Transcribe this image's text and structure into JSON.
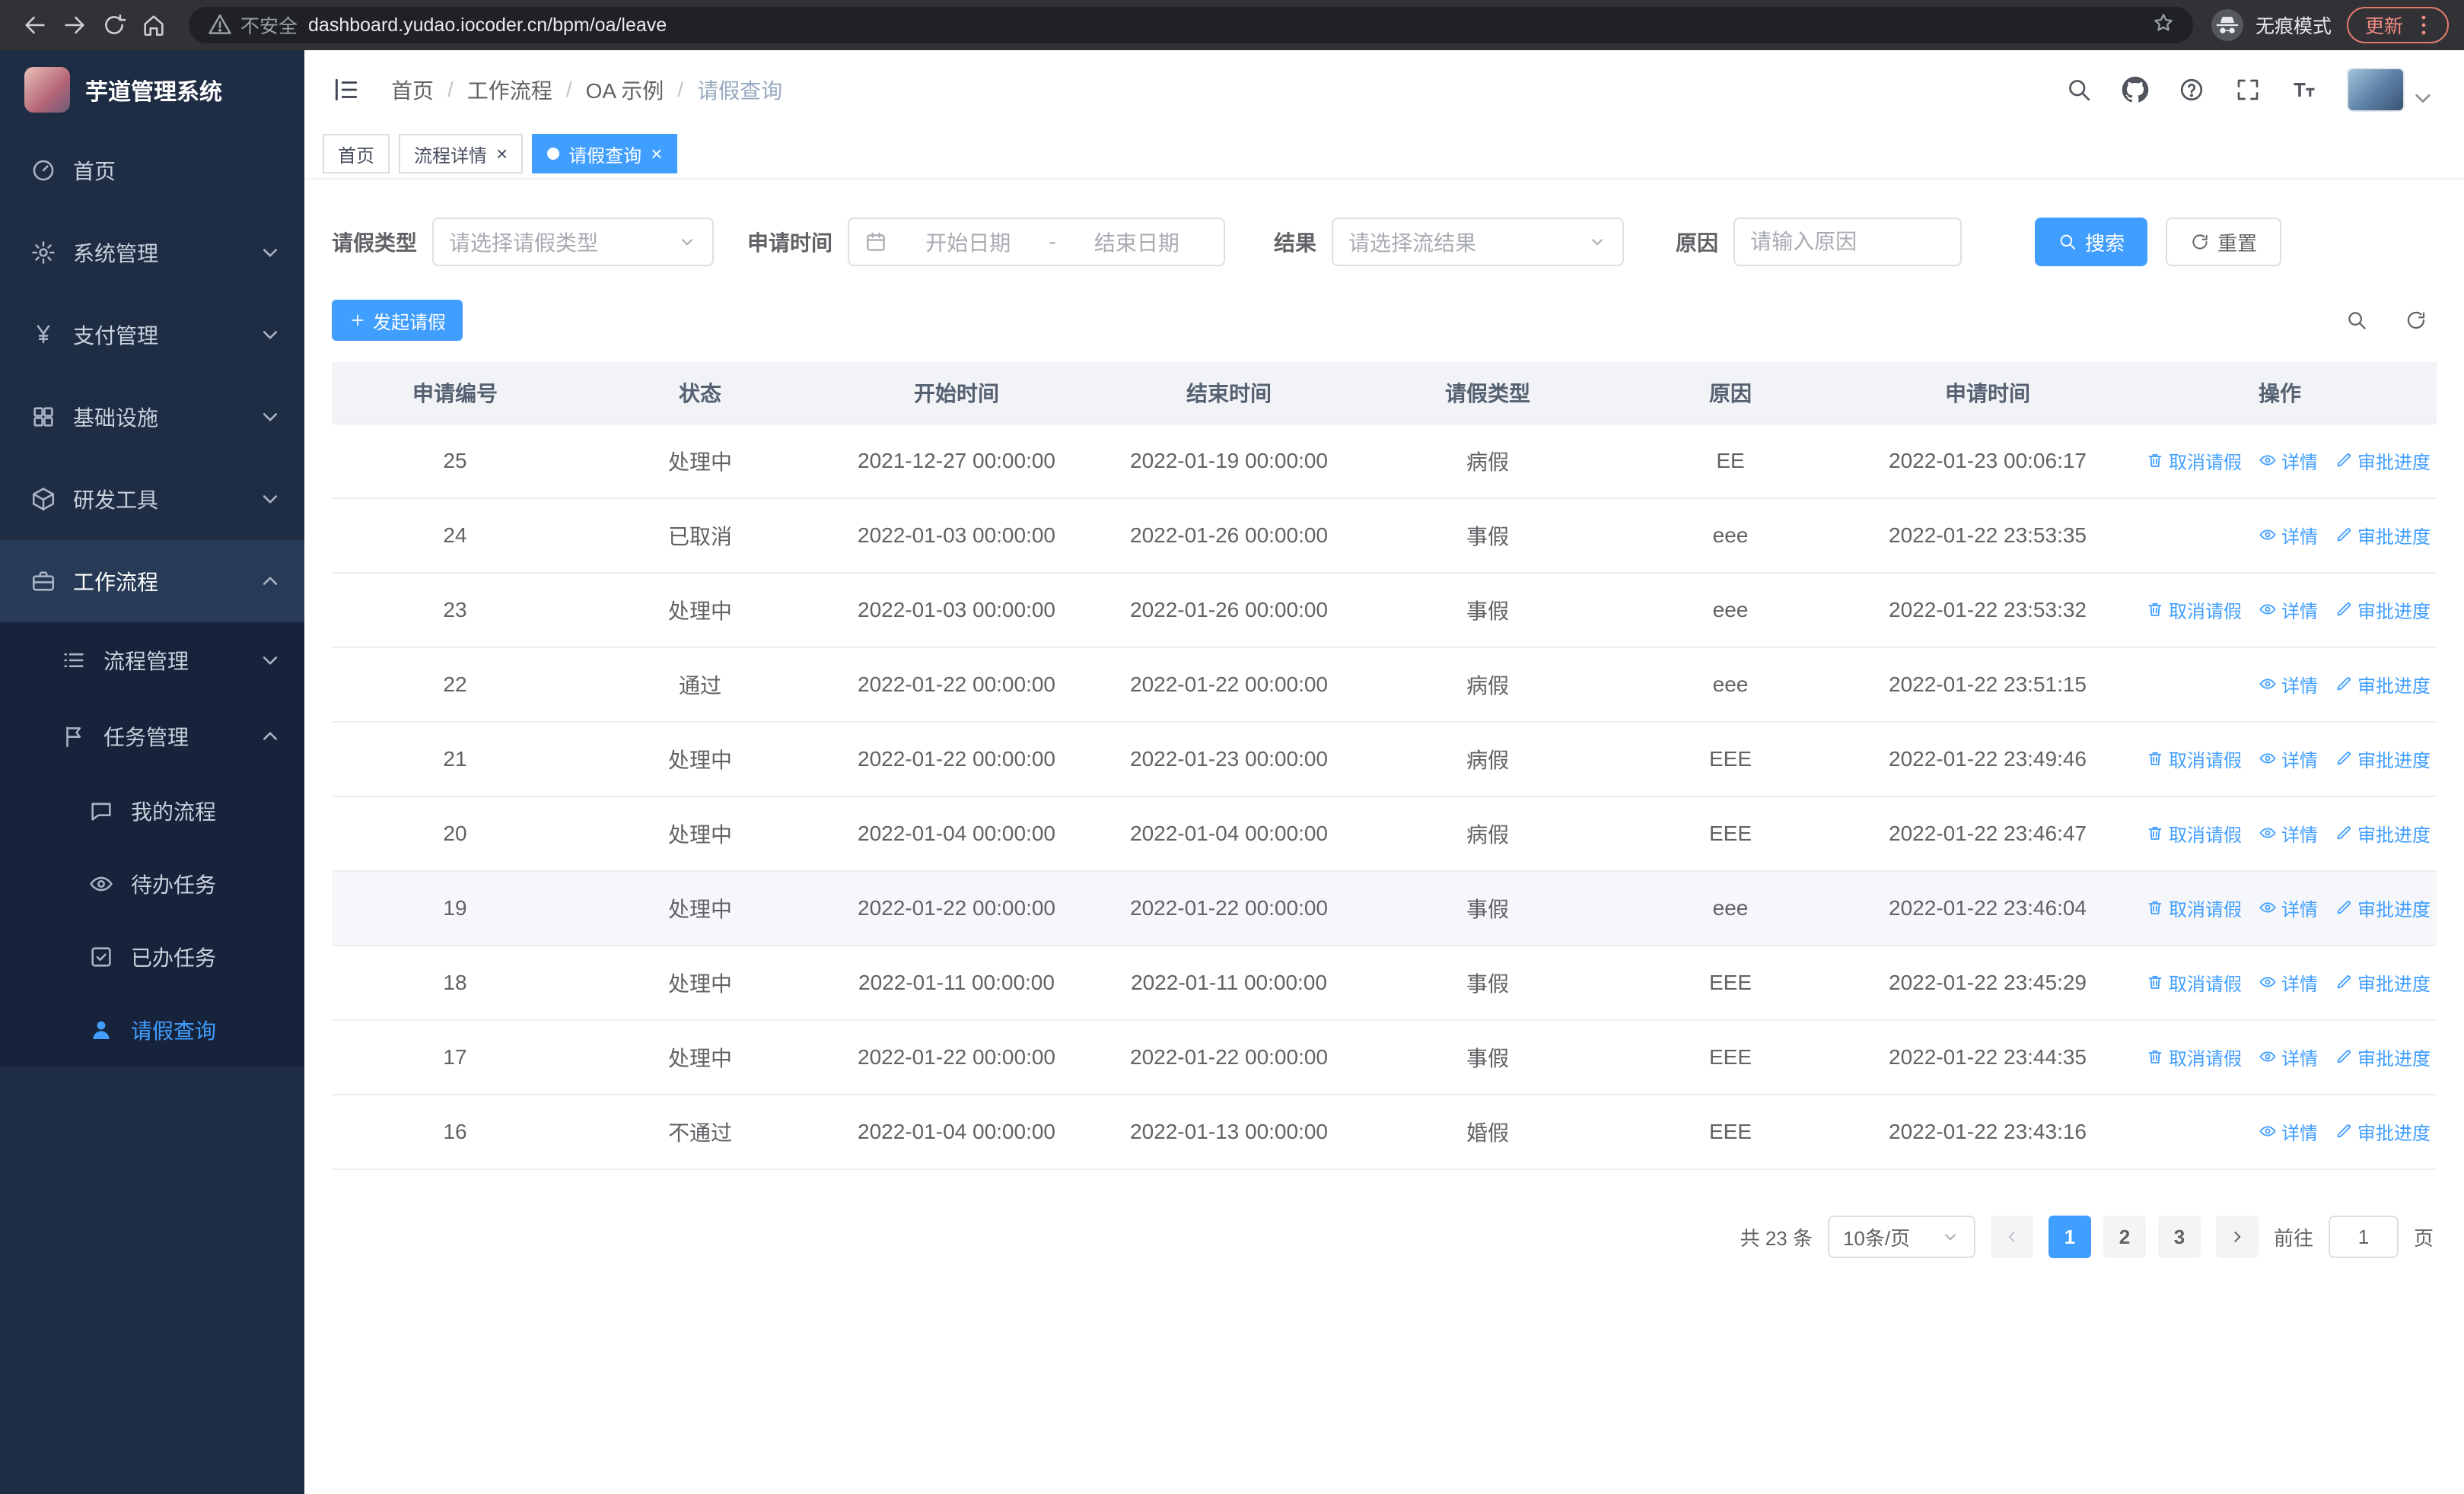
{
  "browser": {
    "security_warning": "不安全",
    "url": "dashboard.yudao.iocoder.cn/bpm/oa/leave",
    "incognito_label": "无痕模式",
    "update_label": "更新"
  },
  "app": {
    "title": "芋道管理系统"
  },
  "sidebar": {
    "items": [
      {
        "label": "首页"
      },
      {
        "label": "系统管理"
      },
      {
        "label": "支付管理"
      },
      {
        "label": "基础设施"
      },
      {
        "label": "研发工具"
      },
      {
        "label": "工作流程"
      }
    ],
    "workflow_children": [
      {
        "label": "流程管理"
      },
      {
        "label": "任务管理"
      }
    ],
    "task_children": [
      {
        "label": "我的流程"
      },
      {
        "label": "待办任务"
      },
      {
        "label": "已办任务"
      },
      {
        "label": "请假查询"
      }
    ]
  },
  "breadcrumb": {
    "items": [
      "首页",
      "工作流程",
      "OA 示例",
      "请假查询"
    ]
  },
  "tabs": [
    {
      "label": "首页"
    },
    {
      "label": "流程详情"
    },
    {
      "label": "请假查询"
    }
  ],
  "filters": {
    "leave_type_label": "请假类型",
    "leave_type_placeholder": "请选择请假类型",
    "apply_time_label": "申请时间",
    "start_placeholder": "开始日期",
    "range_separator": "-",
    "end_placeholder": "结束日期",
    "result_label": "结果",
    "result_placeholder": "请选择流结果",
    "reason_label": "原因",
    "reason_placeholder": "请输入原因",
    "search_label": "搜索",
    "reset_label": "重置"
  },
  "toolbar": {
    "create_label": "发起请假"
  },
  "table": {
    "columns": [
      "申请编号",
      "状态",
      "开始时间",
      "结束时间",
      "请假类型",
      "原因",
      "申请时间",
      "操作"
    ],
    "action_labels": {
      "cancel": "取消请假",
      "detail": "详情",
      "progress": "审批进度"
    },
    "rows": [
      {
        "id": "25",
        "status": "处理中",
        "start": "2021-12-27 00:00:00",
        "end": "2022-01-19 00:00:00",
        "type": "病假",
        "reason": "EE",
        "applied": "2022-01-23 00:06:17",
        "can_cancel": true,
        "highlight": false
      },
      {
        "id": "24",
        "status": "已取消",
        "start": "2022-01-03 00:00:00",
        "end": "2022-01-26 00:00:00",
        "type": "事假",
        "reason": "eee",
        "applied": "2022-01-22 23:53:35",
        "can_cancel": false,
        "highlight": false
      },
      {
        "id": "23",
        "status": "处理中",
        "start": "2022-01-03 00:00:00",
        "end": "2022-01-26 00:00:00",
        "type": "事假",
        "reason": "eee",
        "applied": "2022-01-22 23:53:32",
        "can_cancel": true,
        "highlight": false
      },
      {
        "id": "22",
        "status": "通过",
        "start": "2022-01-22 00:00:00",
        "end": "2022-01-22 00:00:00",
        "type": "病假",
        "reason": "eee",
        "applied": "2022-01-22 23:51:15",
        "can_cancel": false,
        "highlight": false
      },
      {
        "id": "21",
        "status": "处理中",
        "start": "2022-01-22 00:00:00",
        "end": "2022-01-23 00:00:00",
        "type": "病假",
        "reason": "EEE",
        "applied": "2022-01-22 23:49:46",
        "can_cancel": true,
        "highlight": false
      },
      {
        "id": "20",
        "status": "处理中",
        "start": "2022-01-04 00:00:00",
        "end": "2022-01-04 00:00:00",
        "type": "病假",
        "reason": "EEE",
        "applied": "2022-01-22 23:46:47",
        "can_cancel": true,
        "highlight": false
      },
      {
        "id": "19",
        "status": "处理中",
        "start": "2022-01-22 00:00:00",
        "end": "2022-01-22 00:00:00",
        "type": "事假",
        "reason": "eee",
        "applied": "2022-01-22 23:46:04",
        "can_cancel": true,
        "highlight": true
      },
      {
        "id": "18",
        "status": "处理中",
        "start": "2022-01-11 00:00:00",
        "end": "2022-01-11 00:00:00",
        "type": "事假",
        "reason": "EEE",
        "applied": "2022-01-22 23:45:29",
        "can_cancel": true,
        "highlight": false
      },
      {
        "id": "17",
        "status": "处理中",
        "start": "2022-01-22 00:00:00",
        "end": "2022-01-22 00:00:00",
        "type": "事假",
        "reason": "EEE",
        "applied": "2022-01-22 23:44:35",
        "can_cancel": true,
        "highlight": false
      },
      {
        "id": "16",
        "status": "不通过",
        "start": "2022-01-04 00:00:00",
        "end": "2022-01-13 00:00:00",
        "type": "婚假",
        "reason": "EEE",
        "applied": "2022-01-22 23:43:16",
        "can_cancel": false,
        "highlight": false
      }
    ]
  },
  "pagination": {
    "total": "共 23 条",
    "page_size": "10条/页",
    "pages": [
      "1",
      "2",
      "3"
    ],
    "active_page": "1",
    "goto_label": "前往",
    "goto_value": "1",
    "unit_label": "页"
  },
  "colors": {
    "accent": "#409eff",
    "sidebar_bg": "#1f2d44",
    "update_warn": "#f28b82"
  }
}
